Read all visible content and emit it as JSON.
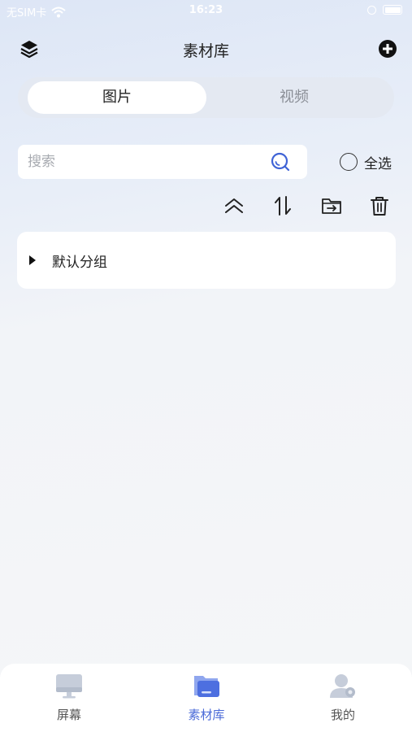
{
  "status_bar": {
    "carrier": "无SIM卡",
    "time": "16:23"
  },
  "nav": {
    "title": "素材库",
    "left_icon": "layers-icon",
    "right_icon": "add-circle-icon"
  },
  "segment": {
    "tabs": [
      {
        "label": "图片",
        "active": true
      },
      {
        "label": "视频",
        "active": false
      }
    ]
  },
  "search": {
    "placeholder": "搜索",
    "value": ""
  },
  "select_all": {
    "label": "全选",
    "checked": false
  },
  "toolbar": {
    "icons": [
      "collapse-up-icon",
      "sort-icon",
      "move-to-folder-icon",
      "trash-icon"
    ]
  },
  "groups": [
    {
      "label": "默认分组",
      "expanded": false
    }
  ],
  "tab_bar": {
    "items": [
      {
        "label": "屏幕",
        "icon": "monitor-icon",
        "active": false
      },
      {
        "label": "素材库",
        "icon": "folder-icon",
        "active": true
      },
      {
        "label": "我的",
        "icon": "user-icon",
        "active": false
      }
    ]
  },
  "colors": {
    "accent": "#4a6ad8",
    "inactive_text": "#8a8e96"
  }
}
